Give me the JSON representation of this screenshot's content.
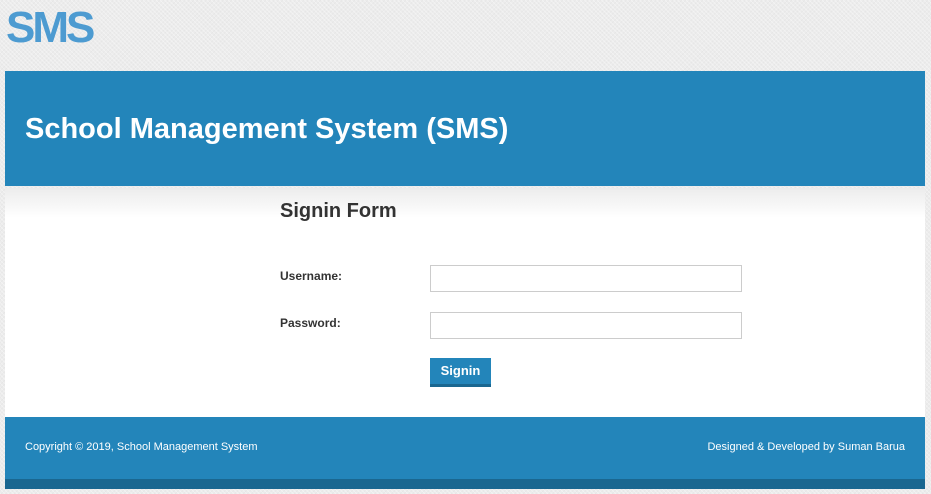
{
  "header": {
    "logo_text": "SMS"
  },
  "banner": {
    "title": "School Management System (SMS)"
  },
  "form": {
    "title": "Signin Form",
    "username_label": "Username:",
    "username_value": "",
    "password_label": "Password:",
    "password_value": "",
    "submit_label": "Signin"
  },
  "footer": {
    "copyright": "Copyright © 2019, School Management System",
    "credit": "Designed & Developed by Suman Barua"
  },
  "colors": {
    "primary": "#2385ba",
    "primary_dark": "#1a6790",
    "logo": "#4d9bd1",
    "background": "#ececec"
  }
}
